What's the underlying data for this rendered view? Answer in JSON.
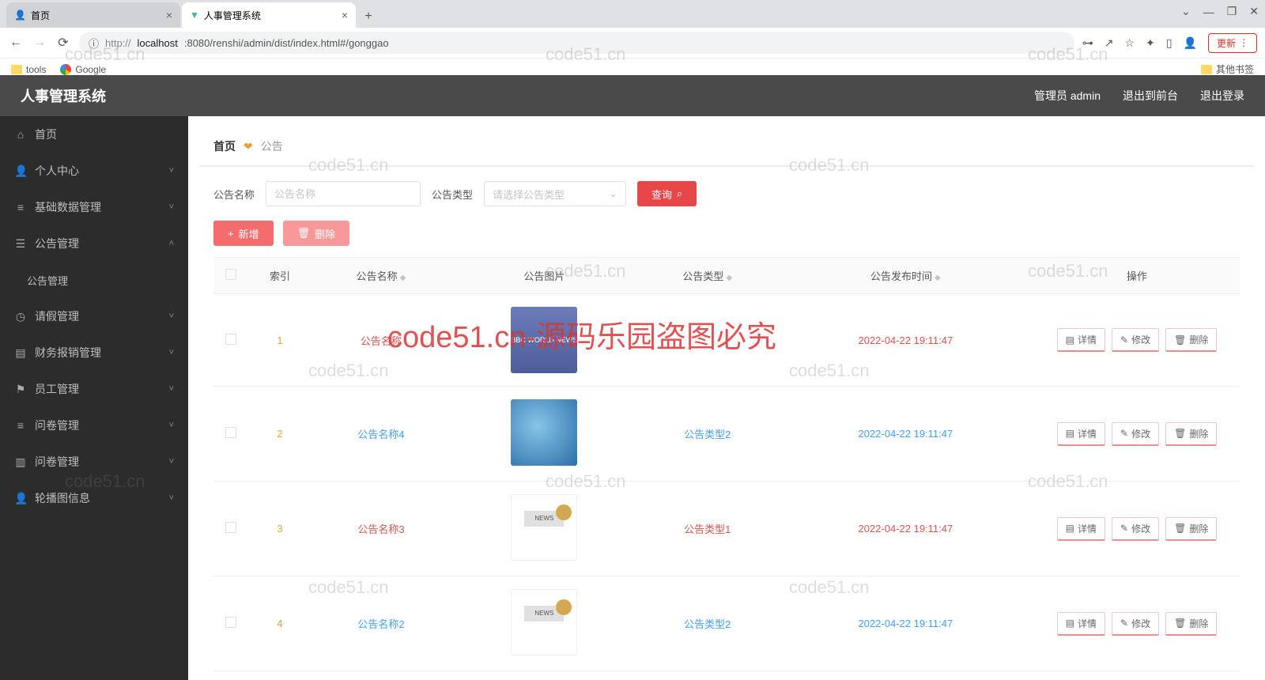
{
  "browser": {
    "tabs": [
      {
        "title": "首页",
        "icon": "person-icon"
      },
      {
        "title": "人事管理系统",
        "icon": "vue-icon"
      }
    ],
    "url_prefix_protocol": "http://",
    "url_host": "localhost",
    "url_port_path": ":8080/renshi/admin/dist/index.html#/gonggao",
    "update_label": "更新",
    "bookmarks": {
      "tools": "tools",
      "google": "Google",
      "other": "其他书签"
    }
  },
  "header": {
    "title": "人事管理系统",
    "user_label": "管理员 admin",
    "exit_front_label": "退出到前台",
    "logout_label": "退出登录"
  },
  "sidebar": {
    "items": [
      {
        "label": "首页",
        "icon": "home"
      },
      {
        "label": "个人中心",
        "icon": "user",
        "expandable": true
      },
      {
        "label": "基础数据管理",
        "icon": "db",
        "expandable": true
      },
      {
        "label": "公告管理",
        "icon": "list",
        "expandable": true,
        "open": true
      },
      {
        "label": "公告管理",
        "sub": true
      },
      {
        "label": "请假管理",
        "icon": "clock",
        "expandable": true
      },
      {
        "label": "财务报销管理",
        "icon": "money",
        "expandable": true
      },
      {
        "label": "员工管理",
        "icon": "staff",
        "expandable": true
      },
      {
        "label": "问卷管理",
        "icon": "survey",
        "expandable": true
      },
      {
        "label": "问卷管理",
        "icon": "survey2",
        "expandable": true
      },
      {
        "label": "轮播图信息",
        "icon": "carousel",
        "expandable": true
      }
    ]
  },
  "breadcrumb": {
    "home": "首页",
    "current": "公告"
  },
  "search": {
    "name_label": "公告名称",
    "name_placeholder": "公告名称",
    "type_label": "公告类型",
    "type_placeholder": "请选择公告类型",
    "query_btn": "查询"
  },
  "action_bar": {
    "add": "新增",
    "delete": "删除"
  },
  "table": {
    "columns": {
      "index": "索引",
      "name": "公告名称",
      "image": "公告图片",
      "type": "公告类型",
      "time": "公告发布时间",
      "action": "操作"
    },
    "actions": {
      "detail": "详情",
      "edit": "修改",
      "delete": "删除"
    },
    "rows": [
      {
        "index": "1",
        "name": "公告名称",
        "type": "",
        "time": "2022-04-22 19:11:47",
        "alt": true,
        "img": "img1",
        "img_text": "BBC WORLD NEWS"
      },
      {
        "index": "2",
        "name": "公告名称4",
        "type": "公告类型2",
        "time": "2022-04-22 19:11:47",
        "alt": false,
        "img": "img2",
        "img_text": ""
      },
      {
        "index": "3",
        "name": "公告名称3",
        "type": "公告类型1",
        "time": "2022-04-22 19:11:47",
        "alt": true,
        "img": "img3",
        "img_text": "NEWS"
      },
      {
        "index": "4",
        "name": "公告名称2",
        "type": "公告类型2",
        "time": "2022-04-22 19:11:47",
        "alt": false,
        "img": "img3",
        "img_text": "NEWS"
      }
    ]
  },
  "watermarks": {
    "small": "code51.cn",
    "big": "code51.cn-源码乐园盗图必究"
  }
}
